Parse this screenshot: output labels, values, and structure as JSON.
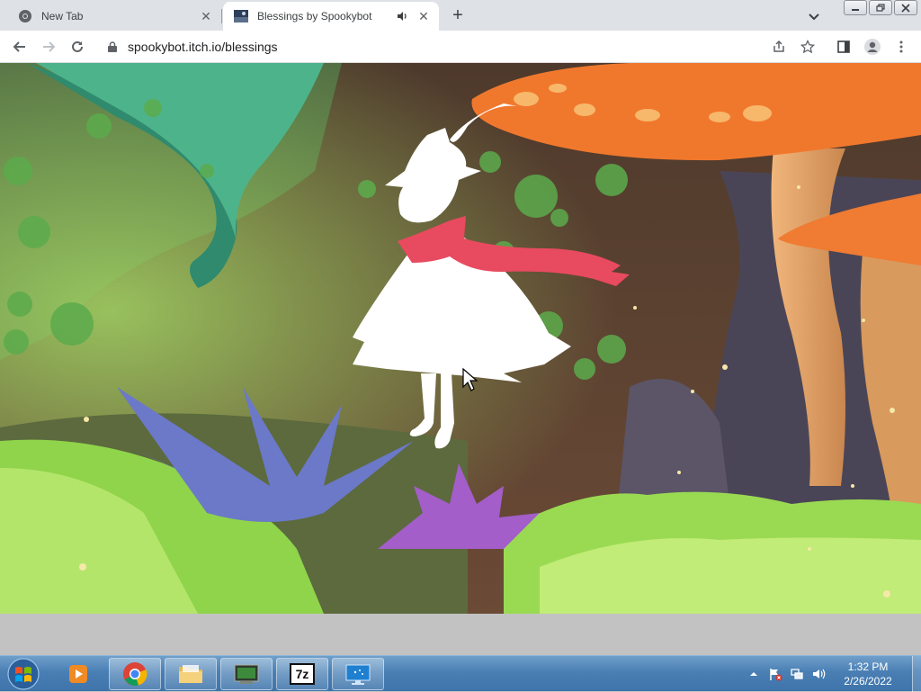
{
  "browser": {
    "tabs": [
      {
        "title": "New Tab",
        "icon": "chrome-icon",
        "active": false
      },
      {
        "title": "Blessings by Spookybot",
        "icon": "game-favicon",
        "active": true,
        "audio": true
      }
    ],
    "address": {
      "url": "spookybot.itch.io/blessings"
    },
    "colors": {
      "tabstrip": "#dee1e6",
      "toolbar": "#ffffff"
    }
  },
  "game": {
    "scene": "forest-scene",
    "character": "white-silhouette-girl-with-red-scarf",
    "colors": {
      "sky": "#5b4030",
      "grass": "#8fd44a",
      "mushroom": "#f0782d",
      "scarf": "#e84a5f",
      "foliage": "#3f8f62"
    }
  },
  "taskbar": {
    "pinned": [
      "media-player-icon",
      "chrome-icon",
      "file-explorer-icon",
      "terminal-icon",
      "7zip-icon",
      "remote-desktop-icon"
    ],
    "labels": {
      "sevenzip": "7z"
    },
    "clock": {
      "time": "1:32 PM",
      "date": "2/26/2022"
    }
  }
}
